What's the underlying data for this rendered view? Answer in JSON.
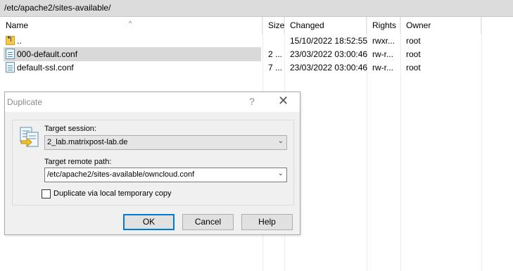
{
  "path": "/etc/apache2/sites-available/",
  "columns": {
    "name": "Name",
    "size": "Size",
    "changed": "Changed",
    "rights": "Rights",
    "owner": "Owner"
  },
  "files": [
    {
      "name": "..",
      "size": "",
      "changed": "15/10/2022 18:52:55",
      "rights": "rwxr...",
      "owner": "root",
      "icon": "parent-folder-icon"
    },
    {
      "name": "000-default.conf",
      "size": "2 ...",
      "changed": "23/03/2022 03:00:46",
      "rights": "rw-r...",
      "owner": "root",
      "icon": "file-icon",
      "selected": true
    },
    {
      "name": "default-ssl.conf",
      "size": "7 ...",
      "changed": "23/03/2022 03:00:46",
      "rights": "rw-r...",
      "owner": "root",
      "icon": "file-icon"
    }
  ],
  "dialog": {
    "title": "Duplicate",
    "help_glyph": "?",
    "close_glyph": "✕",
    "target_session_label": "Target session:",
    "target_session_value": "2_lab.matrixpost-lab.de",
    "target_path_label": "Target remote path:",
    "target_path_value": "/etc/apache2/sites-available/owncloud.conf",
    "checkbox_label": "Duplicate via local temporary copy",
    "checkbox_checked": false,
    "ok": "OK",
    "cancel": "Cancel",
    "help": "Help"
  },
  "colors": {
    "selection": "#d9d9d9",
    "default_button_border": "#0078d7",
    "path_bar": "#dcdcdc"
  }
}
